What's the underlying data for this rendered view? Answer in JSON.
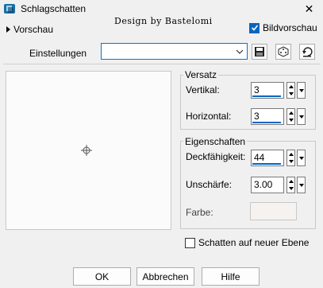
{
  "window": {
    "title": "Schlagschatten",
    "close_glyph": "✕"
  },
  "preview_row": {
    "vorschau_label": "Vorschau",
    "design_label": "Design by Bastelomi",
    "bildvorschau_label": "Bildvorschau",
    "bildvorschau_checked": true
  },
  "settings": {
    "label": "Einstellungen",
    "value": ""
  },
  "versatz": {
    "title": "Versatz",
    "vertikal_label": "Vertikal:",
    "vertikal_value": "3",
    "horizontal_label": "Horizontal:",
    "horizontal_value": "3"
  },
  "eigenschaften": {
    "title": "Eigenschaften",
    "deckfaehigkeit_label": "Deckfähigkeit:",
    "deckfaehigkeit_value": "44",
    "unschaerfe_label": "Unschärfe:",
    "unschaerfe_value": "3.00",
    "farbe_label": "Farbe:",
    "farbe_color": "#f5f2f0"
  },
  "schatten_checkbox": {
    "label": "Schatten auf neuer Ebene",
    "checked": false
  },
  "buttons": {
    "ok": "OK",
    "abbrechen": "Abbrechen",
    "hilfe": "Hilfe"
  },
  "icons": {
    "app": "drop-shadow-app-icon",
    "save": "save-floppy-icon",
    "dice": "randomize-dice-icon",
    "reset": "reset-arrow-icon",
    "crosshair": "crosshair-icon"
  }
}
